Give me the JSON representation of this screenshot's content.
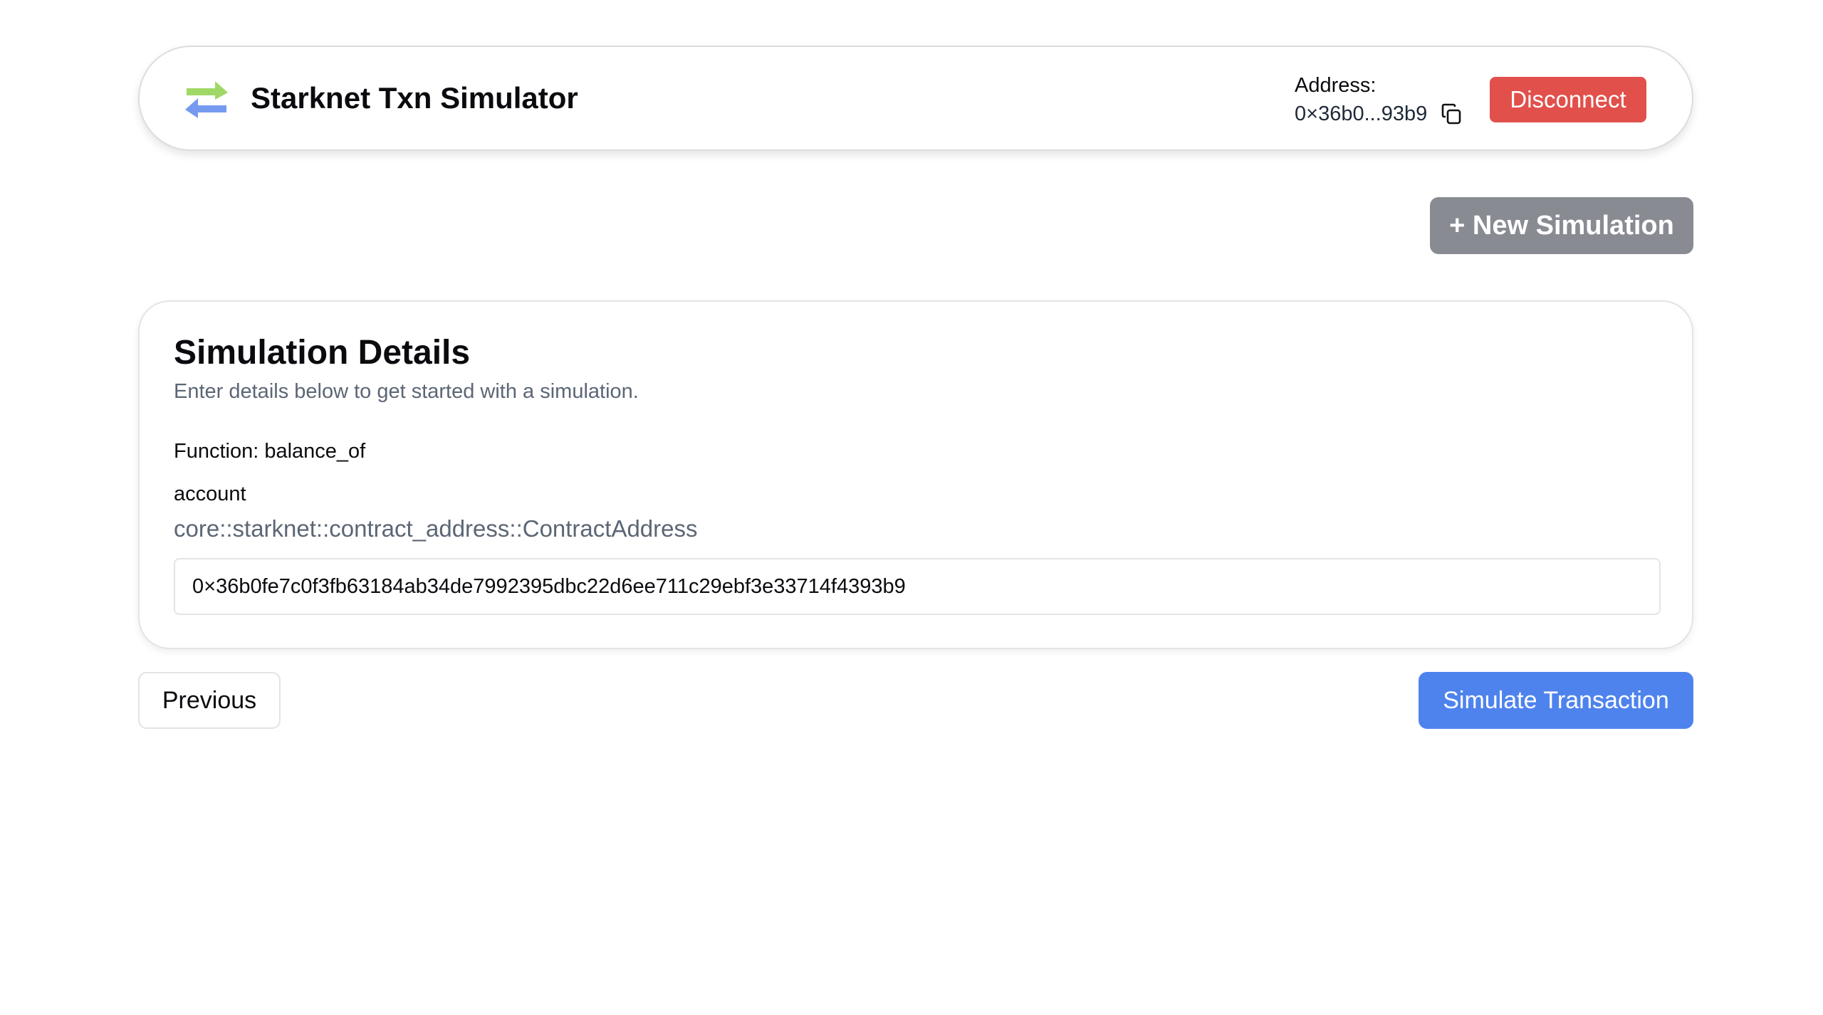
{
  "header": {
    "title": "Starknet Txn Simulator",
    "logo_icon": "swap-arrows-icon",
    "address_label": "Address:",
    "address_value": "0×36b0...93b9",
    "copy_icon": "copy-icon",
    "disconnect_label": "Disconnect"
  },
  "toolbar": {
    "new_simulation_label": "+ New Simulation"
  },
  "card": {
    "title": "Simulation Details",
    "description": "Enter details below to get started with a simulation.",
    "function_label": "Function: balance_of",
    "param_name": "account",
    "param_type": "core::starknet::contract_address::ContractAddress",
    "param_value": "0×36b0fe7c0f3fb63184ab34de7992395dbc22d6ee711c29ebf3e33714f4393b9"
  },
  "actions": {
    "previous_label": "Previous",
    "simulate_label": "Simulate Transaction"
  },
  "colors": {
    "disconnect": "#e1504b",
    "new_simulation": "#898b92",
    "simulate": "#4e83ee",
    "logo_green": "#9bd65f",
    "logo_blue": "#6f95ef"
  }
}
